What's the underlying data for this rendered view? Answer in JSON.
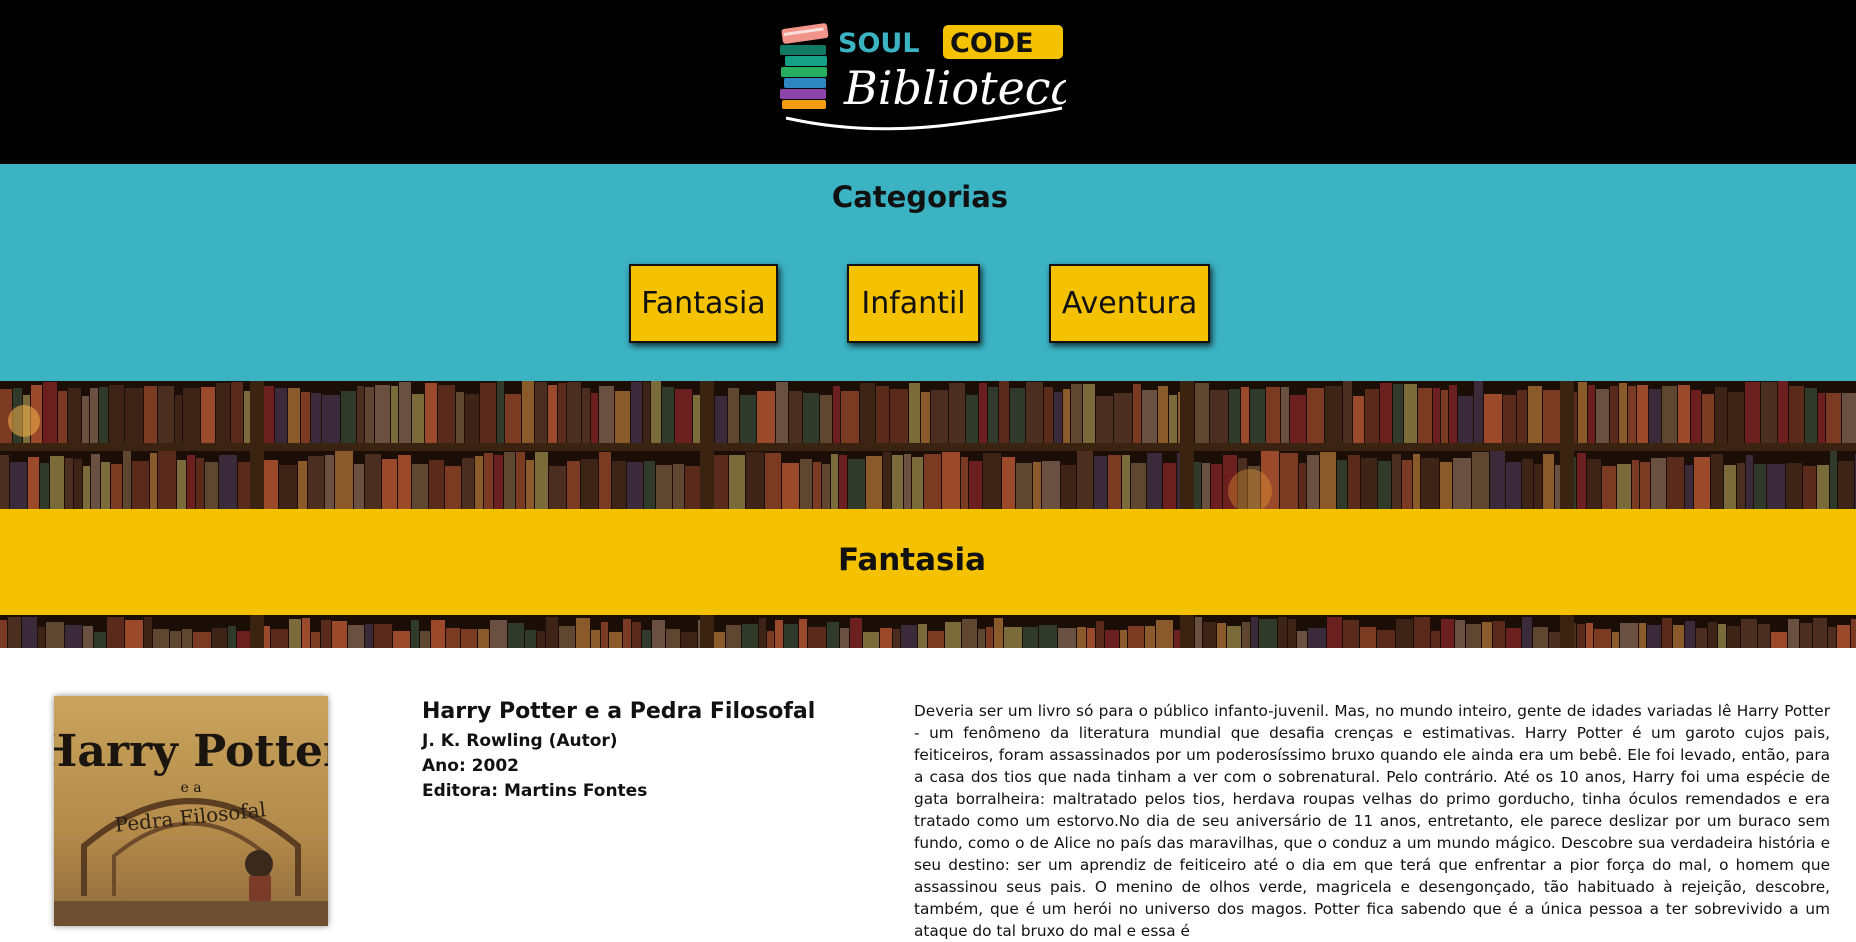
{
  "header": {
    "logo": {
      "text_top_left": "SOUL",
      "text_top_right": "CODE",
      "text_script": "Biblioteca"
    }
  },
  "categories": {
    "title": "Categorias",
    "buttons": [
      {
        "label": "Fantasia"
      },
      {
        "label": "Infantil"
      },
      {
        "label": "Aventura"
      }
    ]
  },
  "genre_banner": {
    "title": "Fantasia"
  },
  "book": {
    "cover": {
      "title_line1": "Harry Potter",
      "title_line2": "e a",
      "title_line3": "Pedra Filosofal"
    },
    "title": "Harry Potter e a Pedra Filosofal",
    "author": "J. K. Rowling (Autor)",
    "year": "Ano: 2002",
    "publisher": "Editora: Martins Fontes",
    "description": "Deveria ser um livro só para o público infanto-juvenil. Mas, no mundo inteiro, gente de idades variadas lê Harry Potter - um fenômeno da literatura mundial que desafia crenças e estimativas. Harry Potter é um garoto cujos pais, feiticeiros, foram assassinados por um poderosíssimo bruxo quando ele ainda era um bebê. Ele foi levado, então, para a casa dos tios que nada tinham a ver com o sobrenatural. Pelo contrário. Até os 10 anos, Harry foi uma espécie de gata borralheira: maltratado pelos tios, herdava roupas velhas do primo gorducho, tinha óculos remendados e era tratado como um estorvo.No dia de seu aniversário de 11 anos, entretanto, ele parece deslizar por um buraco sem fundo, como o de Alice no país das maravilhas, que o conduz a um mundo mágico. Descobre sua verdadeira história e seu destino: ser um aprendiz de feiticeiro até o dia em que terá que enfrentar a pior força do mal, o homem que assassinou seus pais. O menino de olhos verde, magricela e desengonçado, tão habituado à rejeição, descobre, também, que é um herói no universo dos magos. Potter fica sabendo que é a única pessoa a ter sobrevivido a um ataque do tal bruxo do mal e essa é"
  },
  "colors": {
    "header_bg": "#000000",
    "categories_bg": "#3bb3c3",
    "accent_yellow": "#f4c200",
    "text_dark": "#111111"
  }
}
